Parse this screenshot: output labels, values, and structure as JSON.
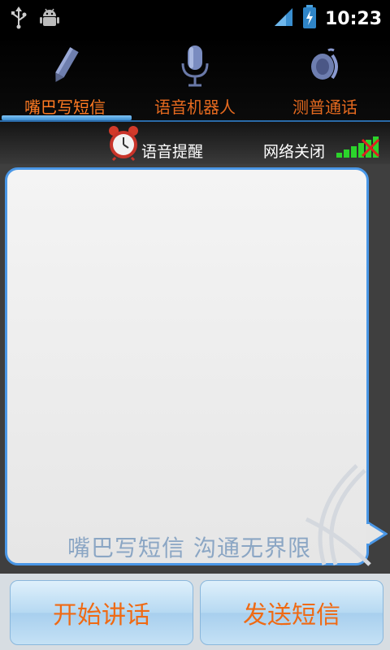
{
  "status_bar": {
    "time": "10:23",
    "left_icons": [
      "usb-icon",
      "android-debug-icon"
    ],
    "right_icons": [
      "cell-signal-icon",
      "battery-charging-icon"
    ]
  },
  "tabs": [
    {
      "label": "嘴巴写短信",
      "icon": "pencil-icon",
      "active": true
    },
    {
      "label": "语音机器人",
      "icon": "microphone-icon",
      "active": false
    },
    {
      "label": "测普通话",
      "icon": "speaker-wave-icon",
      "active": false
    }
  ],
  "info": {
    "reminder_label": "语音提醒",
    "network_label": "网络关闭"
  },
  "bubble": {
    "slogan": "嘴巴写短信 沟通无界限"
  },
  "buttons": {
    "start": "开始讲话",
    "send": "发送短信"
  },
  "colors": {
    "accent_orange": "#ef6a14",
    "bubble_border": "#4a97e6",
    "tab_underline": "#3d8fd2",
    "signal_green": "#2bd42b",
    "signal_off_red": "#e02020"
  }
}
